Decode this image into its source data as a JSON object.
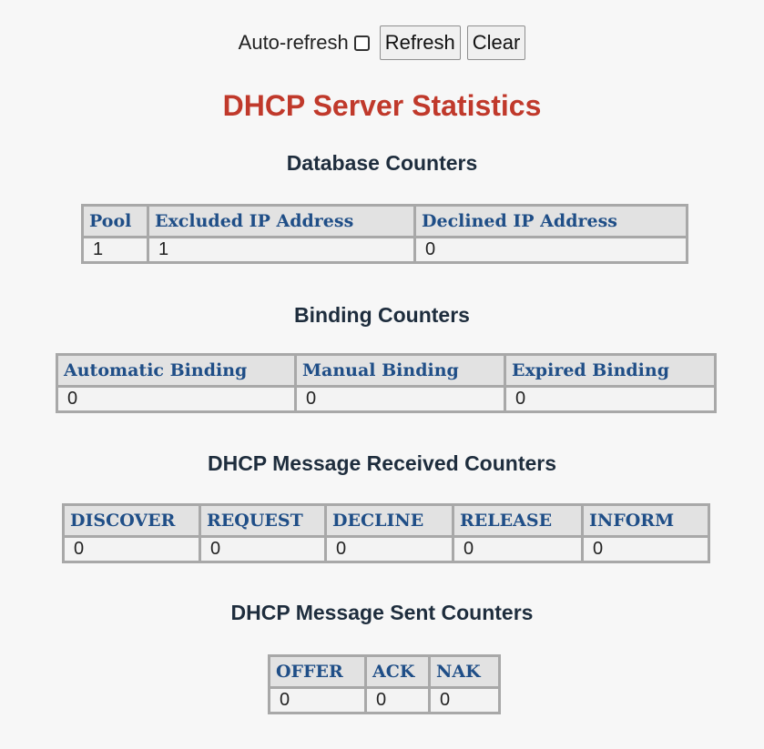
{
  "controls": {
    "auto_refresh_label": "Auto-refresh",
    "auto_refresh_checked": false,
    "refresh_label": "Refresh",
    "clear_label": "Clear"
  },
  "title": "DHCP Server Statistics",
  "database": {
    "heading": "Database Counters",
    "headers": [
      "Pool",
      "Excluded IP Address",
      "Declined IP Address"
    ],
    "values": [
      "1",
      "1",
      "0"
    ]
  },
  "binding": {
    "heading": "Binding Counters",
    "headers": [
      "Automatic Binding",
      "Manual Binding",
      "Expired Binding"
    ],
    "values": [
      "0",
      "0",
      "0"
    ]
  },
  "received": {
    "heading": "DHCP Message Received Counters",
    "headers": [
      "DISCOVER",
      "REQUEST",
      "DECLINE",
      "RELEASE",
      "INFORM"
    ],
    "values": [
      "0",
      "0",
      "0",
      "0",
      "0"
    ]
  },
  "sent": {
    "heading": "DHCP Message Sent Counters",
    "headers": [
      "OFFER",
      "ACK",
      "NAK"
    ],
    "values": [
      "0",
      "0",
      "0"
    ]
  },
  "colors": {
    "title": "#c0392b",
    "header_text": "#1f4e87",
    "section_heading": "#1e2d3d"
  }
}
